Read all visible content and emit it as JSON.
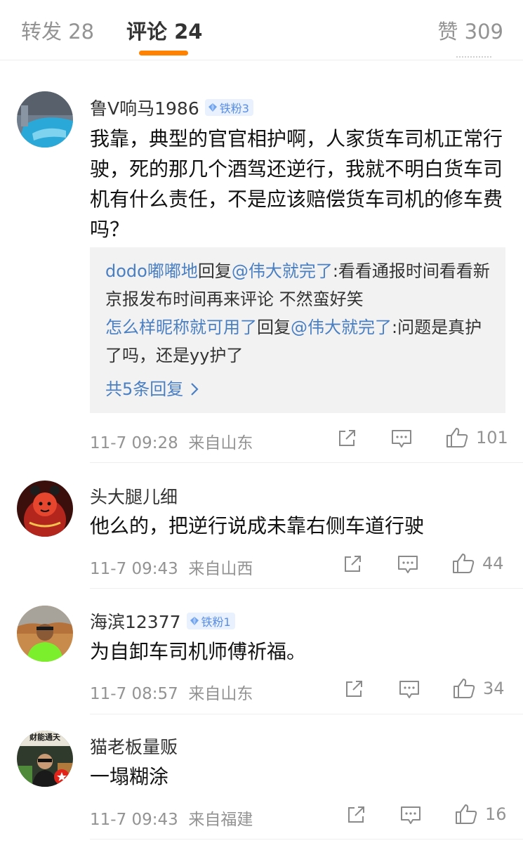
{
  "tabs": {
    "repost": "转发 28",
    "comments": "评论 24",
    "likes": "赞 309"
  },
  "comments": [
    {
      "username": "鲁V响马1986",
      "badge": "铁粉3",
      "text": "我靠，典型的官官相护啊，人家货车司机正常行驶，死的那几个酒驾还逆行，我就不明白货车司机有什么责任，不是应该赔偿货车司机的修车费吗？",
      "replies": [
        {
          "user": "dodo嘟嘟地",
          "verb": "回复",
          "target": "@伟大就完了",
          "text": ":看看通报时间看看新京报发布时间再来评论 不然蛮好笑"
        },
        {
          "user": "怎么样昵称就可用了",
          "verb": "回复",
          "target": "@伟大就完了",
          "text": ":问题是真护了吗，还是yy护了"
        }
      ],
      "more_replies": "共5条回复",
      "time": "11-7 09:28",
      "source": "来自山东",
      "likes": "101"
    },
    {
      "username": "头大腿儿细",
      "text": "他么的，把逆行说成未靠右侧车道行驶",
      "time": "11-7 09:43",
      "source": "来自山西",
      "likes": "44"
    },
    {
      "username": "海滨12377",
      "badge": "铁粉1",
      "text": "为自卸车司机师傅祈福。",
      "time": "11-7 08:57",
      "source": "来自山东",
      "likes": "34"
    },
    {
      "username": "猫老板量贩",
      "text": "一塌糊涂",
      "avatar_caption": "财能通天",
      "time": "11-7 09:43",
      "source": "来自福建",
      "likes": "16"
    }
  ]
}
